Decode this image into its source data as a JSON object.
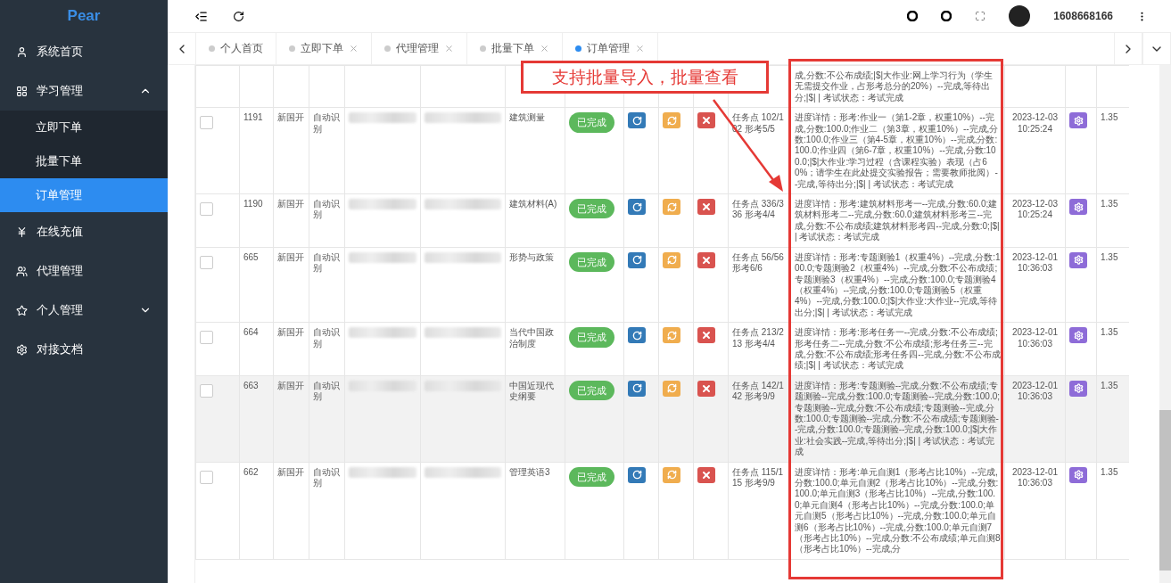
{
  "logo": "Pear",
  "sidebar": {
    "items": [
      {
        "label": "系统首页",
        "selected": false
      },
      {
        "label": "学习管理",
        "expanded": true,
        "selected": false,
        "children": [
          {
            "label": "立即下单",
            "selected": false
          },
          {
            "label": "批量下单",
            "selected": false
          },
          {
            "label": "订单管理",
            "selected": true
          }
        ]
      },
      {
        "label": "在线充值",
        "selected": false
      },
      {
        "label": "代理管理",
        "selected": false
      },
      {
        "label": "个人管理",
        "expanded": false,
        "selected": false
      },
      {
        "label": "对接文档",
        "selected": false
      }
    ]
  },
  "header": {
    "username": "1608668166"
  },
  "tabs": [
    {
      "label": "个人首页",
      "closable": false,
      "selected": false
    },
    {
      "label": "立即下单",
      "closable": true,
      "selected": false
    },
    {
      "label": "代理管理",
      "closable": true,
      "selected": false
    },
    {
      "label": "批量下单",
      "closable": true,
      "selected": false
    },
    {
      "label": "订单管理",
      "closable": true,
      "selected": true
    }
  ],
  "rows": [
    {
      "details": "成,分数:不公布成绩;|$|大作业:网上学习行为（学生无需提交作业，占形考总分的20%）--完成,等待出分;|$| | 考试状态：考试完成"
    },
    {
      "id": "1191",
      "checked": false,
      "hovered": false,
      "type": "新国开",
      "mode": "自动识别",
      "course": "建筑测量",
      "status": "已完成",
      "progress": "任务点 102/102 形考5/5",
      "details": "进度详情：形考:作业一（第1-2章，权重10%）--完成,分数:100.0;作业二（第3章，权重10%）--完成,分数:100.0;作业三（第4-5章，权重10%）--完成,分数:100.0;作业四（第6-7章，权重10%）--完成,分数:100.0;|$|大作业:学习过程（含课程实验）表现（占60%；请学生在此处提交实验报告；需要教师批阅）--完成,等待出分;|$| | 考试状态：考试完成",
      "time": "2023-12-03 10:25:24",
      "price": "1.35"
    },
    {
      "id": "1190",
      "checked": false,
      "hovered": false,
      "type": "新国开",
      "mode": "自动识别",
      "course": "建筑材料(A)",
      "status": "已完成",
      "progress": "任务点 336/336 形考4/4",
      "details": "进度详情：形考:建筑材料形考一--完成,分数:60.0;建筑材料形考二--完成,分数:60.0;建筑材料形考三--完成,分数:不公布成绩;建筑材料形考四--完成,分数:0;|$| | 考试状态：考试完成",
      "time": "2023-12-03 10:25:24",
      "price": "1.35"
    },
    {
      "id": "665",
      "checked": false,
      "hovered": false,
      "type": "新国开",
      "mode": "自动识别",
      "course": "形势与政策",
      "status": "已完成",
      "progress": "任务点 56/56 形考6/6",
      "details": "进度详情：形考:专题测验1（权重4%）--完成,分数:100.0;专题测验2（权重4%）--完成,分数:不公布成绩;专题测验3（权重4%）--完成,分数:100.0;专题测验4（权重4%）--完成,分数:100.0;专题测验5（权重4%）--完成,分数:100.0;|$|大作业:大作业--完成,等待出分;|$| | 考试状态：考试完成",
      "time": "2023-12-01 10:36:03",
      "price": "1.35"
    },
    {
      "id": "664",
      "checked": false,
      "hovered": false,
      "type": "新国开",
      "mode": "自动识别",
      "course": "当代中国政治制度",
      "status": "已完成",
      "progress": "任务点 213/213 形考4/4",
      "details": "进度详情：形考:形考任务一--完成,分数:不公布成绩;形考任务二--完成,分数:不公布成绩;形考任务三--完成,分数:不公布成绩;形考任务四--完成,分数:不公布成绩;|$| | 考试状态：考试完成",
      "time": "2023-12-01 10:36:03",
      "price": "1.35"
    },
    {
      "id": "663",
      "checked": false,
      "hovered": true,
      "type": "新国开",
      "mode": "自动识别",
      "course": "中国近现代史纲要",
      "status": "已完成",
      "progress": "任务点 142/142 形考9/9",
      "details": "进度详情：形考:专题测验--完成,分数:不公布成绩;专题测验--完成,分数:100.0;专题测验--完成,分数:100.0;专题测验--完成,分数:不公布成绩;专题测验--完成,分数:100.0;专题测验--完成,分数:不公布成绩;专题测验--完成,分数:100.0;专题测验--完成,分数:100.0;|$|大作业:社会实践--完成,等待出分;|$| | 考试状态：考试完成",
      "time": "2023-12-01 10:36:03",
      "price": "1.35"
    },
    {
      "id": "662",
      "checked": false,
      "hovered": false,
      "type": "新国开",
      "mode": "自动识别",
      "course": "管理英语3",
      "status": "已完成",
      "progress": "任务点 115/115 形考9/9",
      "details": "进度详情：形考:单元自测1（形考占比10%）--完成,分数:100.0;单元自测2（形考占比10%）--完成,分数:100.0;单元自测3（形考占比10%）--完成,分数:100.0;单元自测4（形考占比10%）--完成,分数:100.0;单元自测5（形考占比10%）--完成,分数:100.0;单元自测6（形考占比10%）--完成,分数:100.0;单元自测7（形考占比10%）--完成,分数:不公布成绩;单元自测8（形考占比10%）--完成,分",
      "time": "2023-12-01 10:36:03",
      "price": "1.35"
    }
  ],
  "annotation": {
    "callout": "支持批量导入，批量查看"
  }
}
